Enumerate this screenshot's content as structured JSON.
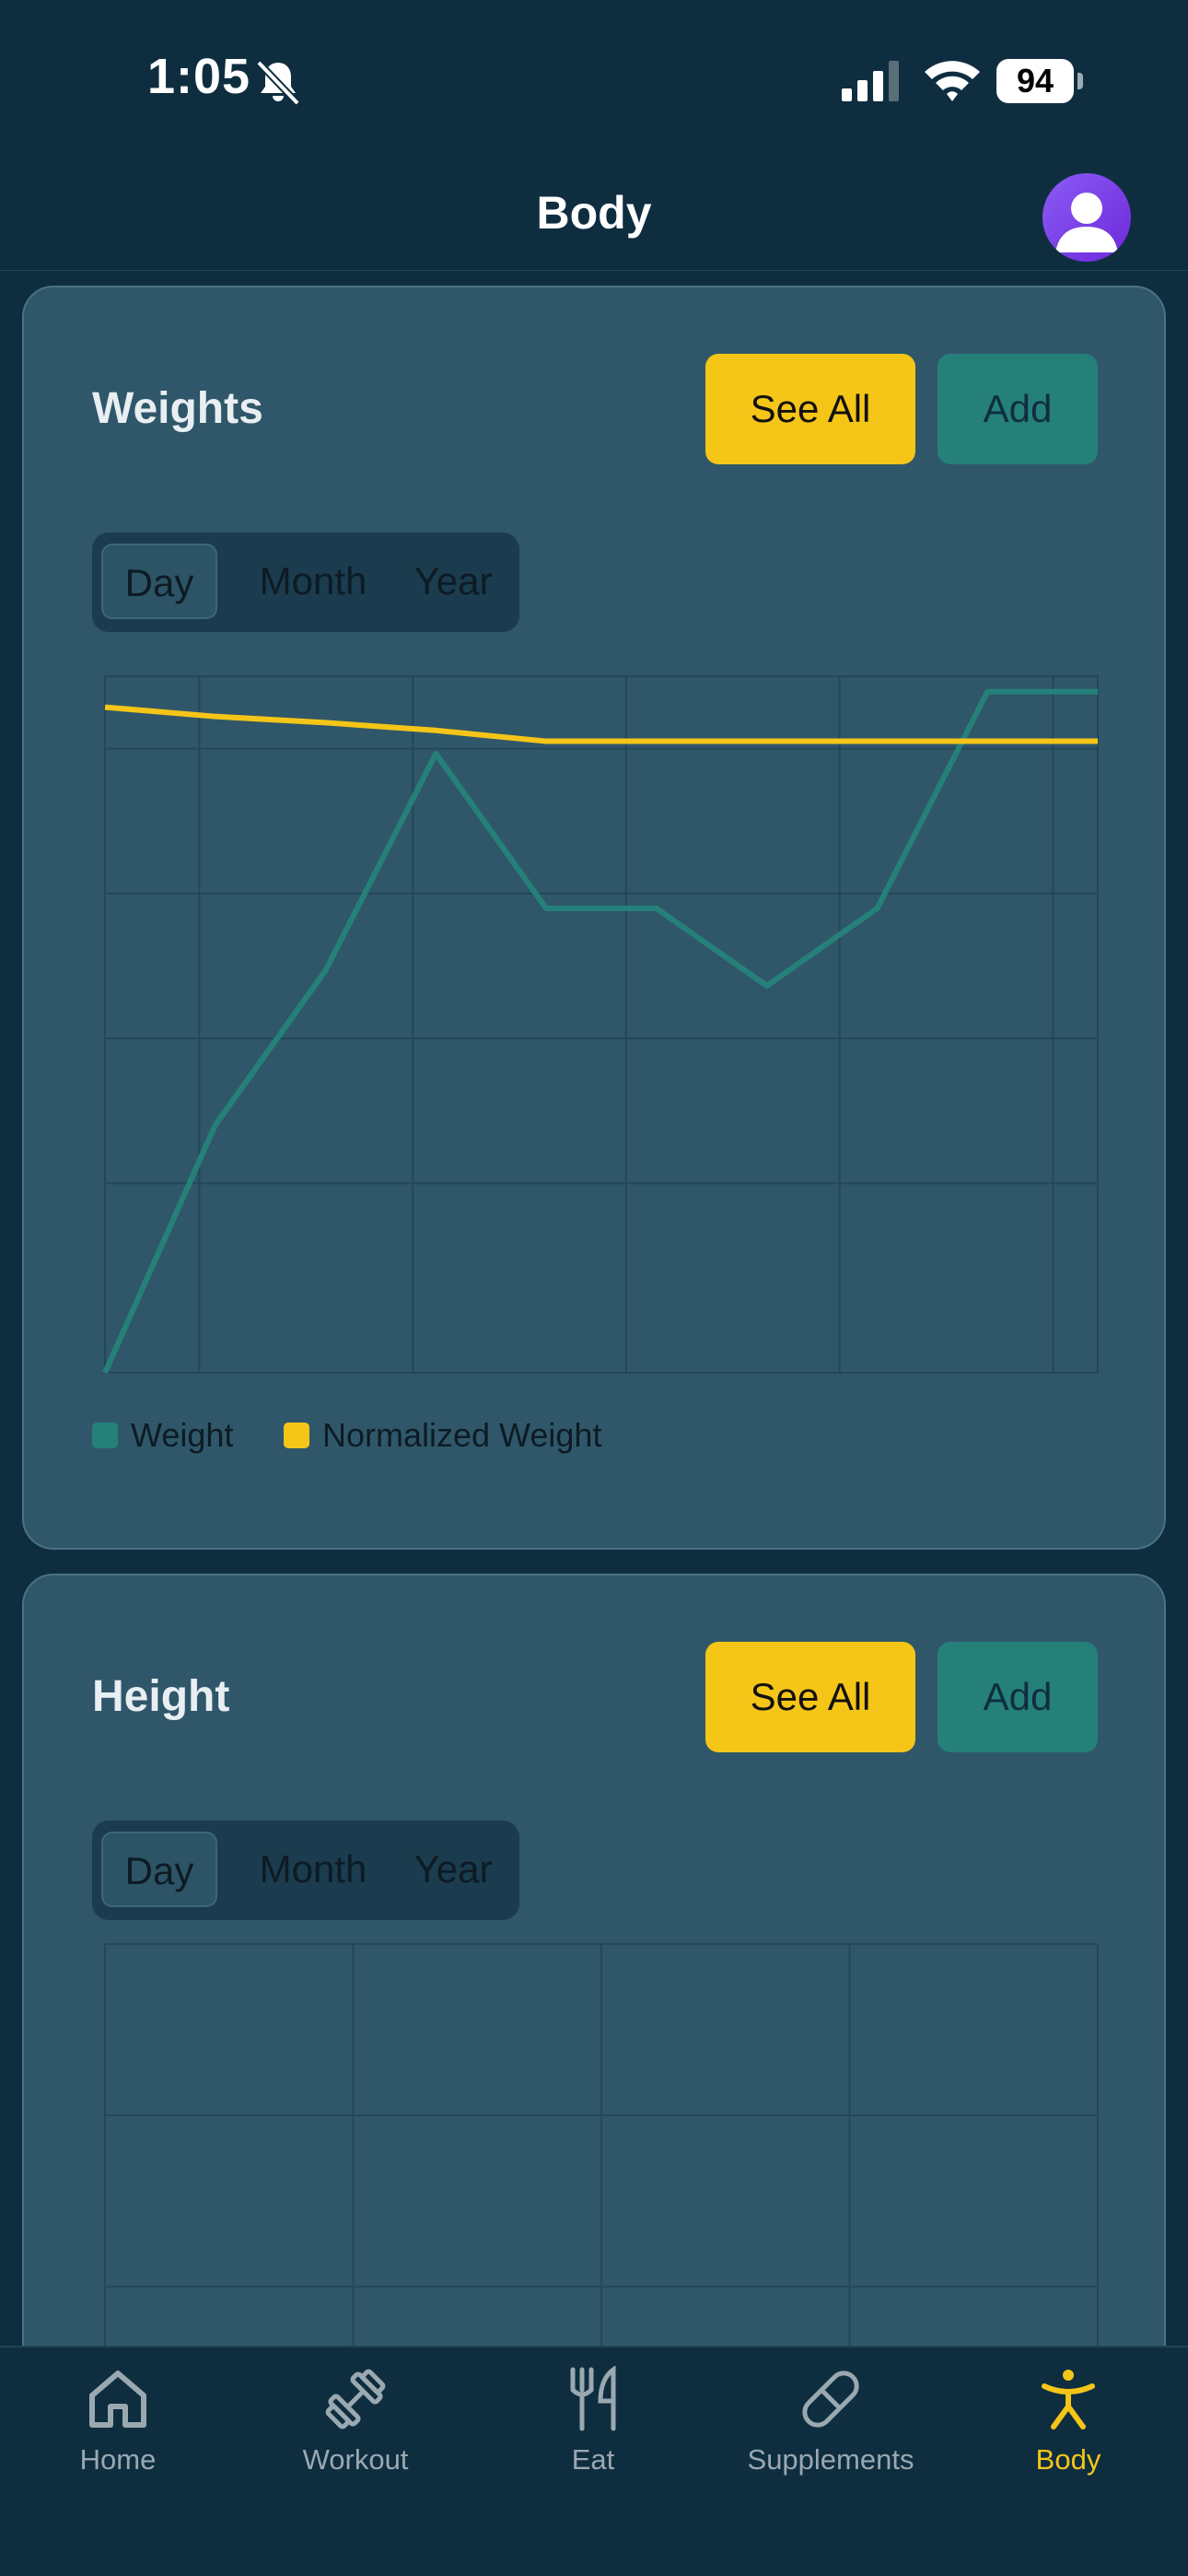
{
  "status_bar": {
    "time": "1:05",
    "battery": "94"
  },
  "header": {
    "title": "Body"
  },
  "weights_card": {
    "title": "Weights",
    "see_all_label": "See All",
    "add_label": "Add",
    "range_tabs": [
      "Day",
      "Month",
      "Year"
    ],
    "selected_range": "Day",
    "legend": [
      "Weight",
      "Normalized Weight"
    ]
  },
  "height_card": {
    "title": "Height",
    "see_all_label": "See All",
    "add_label": "Add",
    "range_tabs": [
      "Day",
      "Month",
      "Year"
    ],
    "selected_range": "Day"
  },
  "chart_data": [
    {
      "type": "line",
      "title": "Weights",
      "x": [
        1,
        2,
        3,
        4,
        5,
        6,
        7,
        8,
        9,
        10
      ],
      "series": [
        {
          "name": "Weight",
          "color": "#26807a",
          "values": [
            0,
            1.6,
            2.6,
            4.0,
            3.0,
            3.0,
            2.5,
            3.0,
            4.4,
            4.4
          ]
        },
        {
          "name": "Normalized Weight",
          "color": "#f5c518",
          "values": [
            4.3,
            4.24,
            4.2,
            4.15,
            4.08,
            4.08,
            4.08,
            4.08,
            4.08,
            4.08
          ]
        }
      ],
      "ylim": [
        0,
        4.5
      ],
      "grid": true,
      "legend_position": "bottom-left"
    },
    {
      "type": "line",
      "title": "Height",
      "series": [],
      "grid": true
    }
  ],
  "nav": {
    "items": [
      {
        "label": "Home",
        "icon": "home-icon"
      },
      {
        "label": "Workout",
        "icon": "dumbbell-icon"
      },
      {
        "label": "Eat",
        "icon": "fork-knife-icon"
      },
      {
        "label": "Supplements",
        "icon": "pill-icon"
      },
      {
        "label": "Body",
        "icon": "body-icon"
      }
    ],
    "active": "Body",
    "active_color": "#f5c518"
  }
}
